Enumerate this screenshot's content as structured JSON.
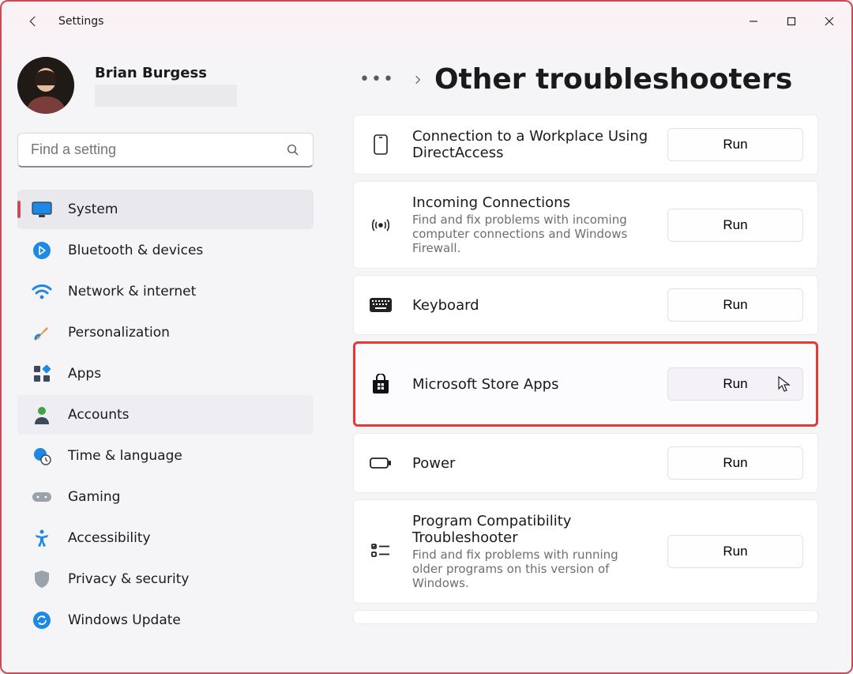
{
  "window": {
    "title": "Settings"
  },
  "profile": {
    "name": "Brian Burgess"
  },
  "search": {
    "placeholder": "Find a setting"
  },
  "nav": [
    {
      "id": "system",
      "label": "System",
      "selected": true
    },
    {
      "id": "bluetooth",
      "label": "Bluetooth & devices",
      "selected": false
    },
    {
      "id": "network",
      "label": "Network & internet",
      "selected": false
    },
    {
      "id": "personalization",
      "label": "Personalization",
      "selected": false
    },
    {
      "id": "apps",
      "label": "Apps",
      "selected": false
    },
    {
      "id": "accounts",
      "label": "Accounts",
      "selected": false,
      "hover": true
    },
    {
      "id": "time",
      "label": "Time & language",
      "selected": false
    },
    {
      "id": "gaming",
      "label": "Gaming",
      "selected": false
    },
    {
      "id": "accessibility",
      "label": "Accessibility",
      "selected": false
    },
    {
      "id": "privacy",
      "label": "Privacy & security",
      "selected": false
    },
    {
      "id": "update",
      "label": "Windows Update",
      "selected": false
    }
  ],
  "breadcrumb": {
    "title": "Other troubleshooters"
  },
  "run_label": "Run",
  "troubleshooters": [
    {
      "id": "directaccess",
      "title": "Connection to a Workplace Using DirectAccess",
      "desc": ""
    },
    {
      "id": "incoming",
      "title": "Incoming Connections",
      "desc": "Find and fix problems with incoming computer connections and Windows Firewall."
    },
    {
      "id": "keyboard",
      "title": "Keyboard",
      "desc": ""
    },
    {
      "id": "store",
      "title": "Microsoft Store Apps",
      "desc": "",
      "highlight": true,
      "cursor": true
    },
    {
      "id": "power",
      "title": "Power",
      "desc": ""
    },
    {
      "id": "compat",
      "title": "Program Compatibility Troubleshooter",
      "desc": "Find and fix problems with running older programs on this version of Windows."
    }
  ]
}
